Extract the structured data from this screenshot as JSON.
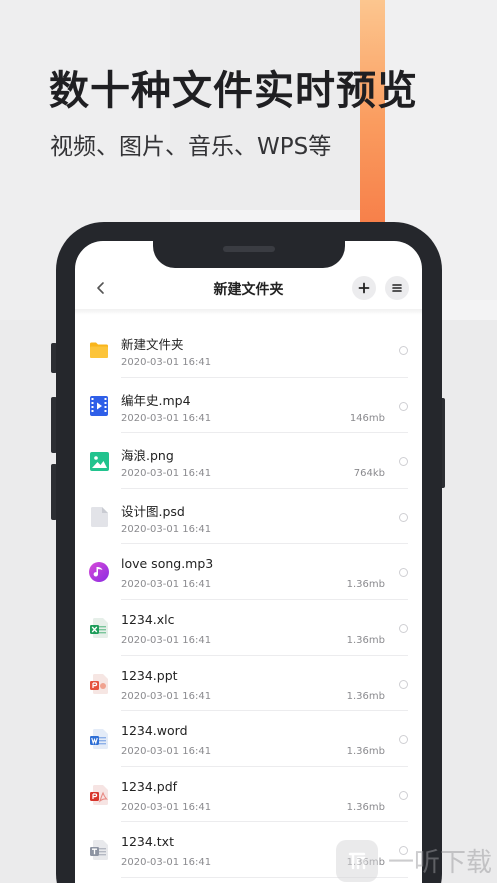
{
  "promo": {
    "headline": "数十种文件实时预览",
    "subhead": "视频、图片、音乐、WPS等"
  },
  "colors": {
    "accent_orange": "#f7804a",
    "folder": "#f9b51b",
    "video": "#2f5fe8",
    "image": "#22c38e",
    "music": "#b12ad8",
    "excel": "#1e9d5a",
    "ppt": "#e5533d",
    "word": "#2e6fd6",
    "pdf": "#d8352b",
    "txt": "#8e95a3"
  },
  "navbar": {
    "back_icon": "chevron-left-icon",
    "title": "新建文件夹",
    "add_icon": "plus-icon",
    "menu_icon": "menu-icon"
  },
  "files": [
    {
      "name": "新建文件夹",
      "date": "2020-03-01 16:41",
      "size": "",
      "icon": "folder-icon"
    },
    {
      "name": "编年史.mp4",
      "date": "2020-03-01 16:41",
      "size": "146mb",
      "icon": "video-file-icon"
    },
    {
      "name": "海浪.png",
      "date": "2020-03-01 16:41",
      "size": "764kb",
      "icon": "image-file-icon"
    },
    {
      "name": "设计图.psd",
      "date": "2020-03-01 16:41",
      "size": "",
      "icon": "generic-file-icon"
    },
    {
      "name": "love song.mp3",
      "date": "2020-03-01 16:41",
      "size": "1.36mb",
      "icon": "music-file-icon"
    },
    {
      "name": "1234.xlc",
      "date": "2020-03-01 16:41",
      "size": "1.36mb",
      "icon": "excel-file-icon"
    },
    {
      "name": "1234.ppt",
      "date": "2020-03-01 16:41",
      "size": "1.36mb",
      "icon": "ppt-file-icon"
    },
    {
      "name": "1234.word",
      "date": "2020-03-01 16:41",
      "size": "1.36mb",
      "icon": "word-file-icon"
    },
    {
      "name": "1234.pdf",
      "date": "2020-03-01 16:41",
      "size": "1.36mb",
      "icon": "pdf-file-icon"
    },
    {
      "name": "1234.txt",
      "date": "2020-03-01 16:41",
      "size": "1.36mb",
      "icon": "txt-file-icon"
    }
  ],
  "watermark": {
    "logo_icon": "yiting-logo-icon",
    "text": "一听下载"
  }
}
